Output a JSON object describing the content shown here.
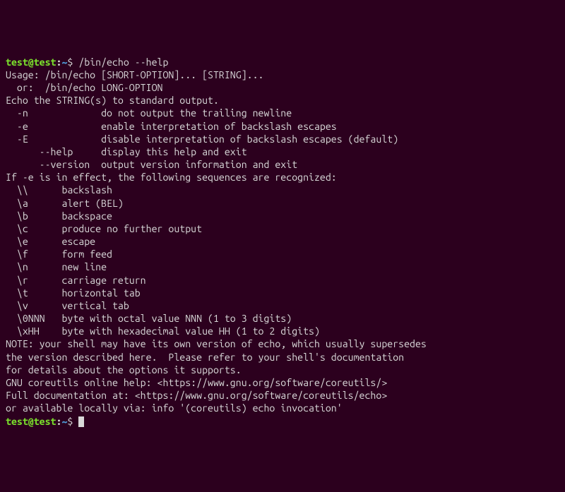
{
  "prompt1": {
    "user": "test@test",
    "colon": ":",
    "path": "~",
    "dollar": "$ ",
    "command": "/bin/echo --help"
  },
  "lines": [
    "Usage: /bin/echo [SHORT-OPTION]... [STRING]...",
    "  or:  /bin/echo LONG-OPTION",
    "Echo the STRING(s) to standard output.",
    "",
    "  -n             do not output the trailing newline",
    "  -e             enable interpretation of backslash escapes",
    "  -E             disable interpretation of backslash escapes (default)",
    "      --help     display this help and exit",
    "      --version  output version information and exit",
    "",
    "If -e is in effect, the following sequences are recognized:",
    "",
    "  \\\\      backslash",
    "  \\a      alert (BEL)",
    "  \\b      backspace",
    "  \\c      produce no further output",
    "  \\e      escape",
    "  \\f      form feed",
    "  \\n      new line",
    "  \\r      carriage return",
    "  \\t      horizontal tab",
    "  \\v      vertical tab",
    "  \\0NNN   byte with octal value NNN (1 to 3 digits)",
    "  \\xHH    byte with hexadecimal value HH (1 to 2 digits)",
    "",
    "NOTE: your shell may have its own version of echo, which usually supersedes",
    "the version described here.  Please refer to your shell's documentation",
    "for details about the options it supports.",
    "",
    "GNU coreutils online help: <https://www.gnu.org/software/coreutils/>",
    "Full documentation at: <https://www.gnu.org/software/coreutils/echo>",
    "or available locally via: info '(coreutils) echo invocation'"
  ],
  "prompt2": {
    "user": "test@test",
    "colon": ":",
    "path": "~",
    "dollar": "$ "
  }
}
